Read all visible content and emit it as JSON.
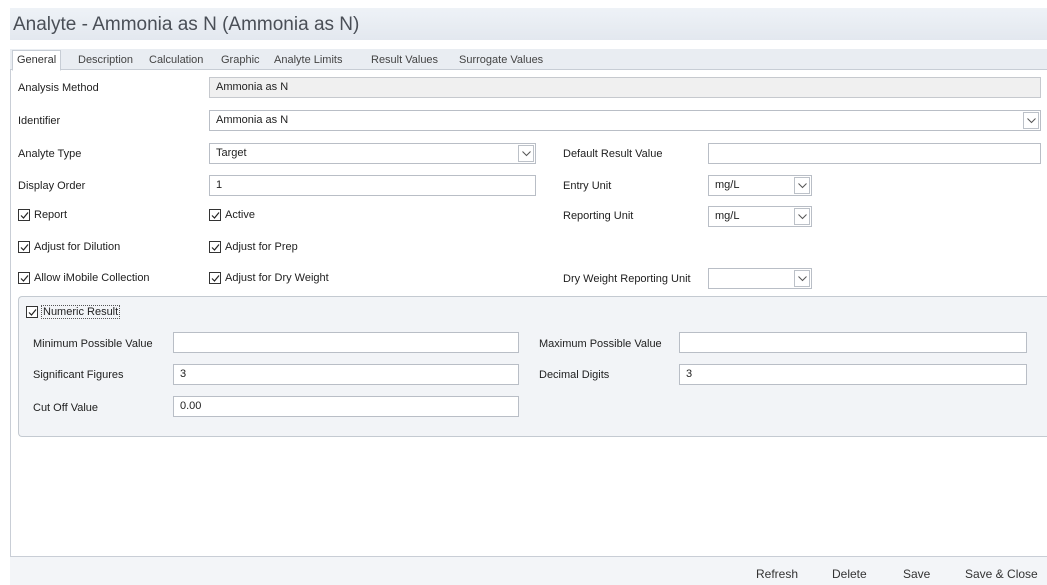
{
  "window": {
    "title": "Analyte - Ammonia as N (Ammonia as N)"
  },
  "tabs": [
    {
      "label": "General",
      "active": true
    },
    {
      "label": "Description"
    },
    {
      "label": "Calculation"
    },
    {
      "label": "Graphic"
    },
    {
      "label": "Analyte Limits"
    },
    {
      "label": "Result Values"
    },
    {
      "label": "Surrogate Values"
    }
  ],
  "form": {
    "analysis_method": {
      "label": "Analysis Method",
      "value": "Ammonia as N"
    },
    "identifier": {
      "label": "Identifier",
      "value": "Ammonia as N"
    },
    "analyte_type": {
      "label": "Analyte Type",
      "value": "Target"
    },
    "default_result_value": {
      "label": "Default Result Value",
      "value": ""
    },
    "display_order": {
      "label": "Display Order",
      "value": "1"
    },
    "entry_unit": {
      "label": "Entry Unit",
      "value": "mg/L"
    },
    "reporting_unit": {
      "label": "Reporting Unit",
      "value": "mg/L"
    },
    "dry_weight_reporting_unit": {
      "label": "Dry Weight Reporting Unit",
      "value": ""
    },
    "checkboxes": {
      "report": {
        "label": "Report",
        "checked": true
      },
      "active": {
        "label": "Active",
        "checked": true
      },
      "adjust_dilution": {
        "label": "Adjust for Dilution",
        "checked": true
      },
      "adjust_prep": {
        "label": "Adjust for Prep",
        "checked": true
      },
      "allow_imobile": {
        "label": "Allow iMobile Collection",
        "checked": true
      },
      "adjust_dry_weight": {
        "label": "Adjust for Dry Weight",
        "checked": true
      }
    }
  },
  "numeric_result": {
    "label": "Numeric Result",
    "checked": true,
    "min_possible": {
      "label": "Minimum Possible Value",
      "value": ""
    },
    "max_possible": {
      "label": "Maximum Possible Value",
      "value": ""
    },
    "significant_figures": {
      "label": "Significant Figures",
      "value": "3"
    },
    "decimal_digits": {
      "label": "Decimal Digits",
      "value": "3"
    },
    "cut_off": {
      "label": "Cut Off Value",
      "value": "0.00"
    }
  },
  "footer": {
    "refresh": "Refresh",
    "delete": "Delete",
    "save": "Save",
    "save_close": "Save & Close"
  },
  "icons": {
    "checkbox": "check-mark-icon",
    "dropdown": "chevron-down-icon"
  }
}
